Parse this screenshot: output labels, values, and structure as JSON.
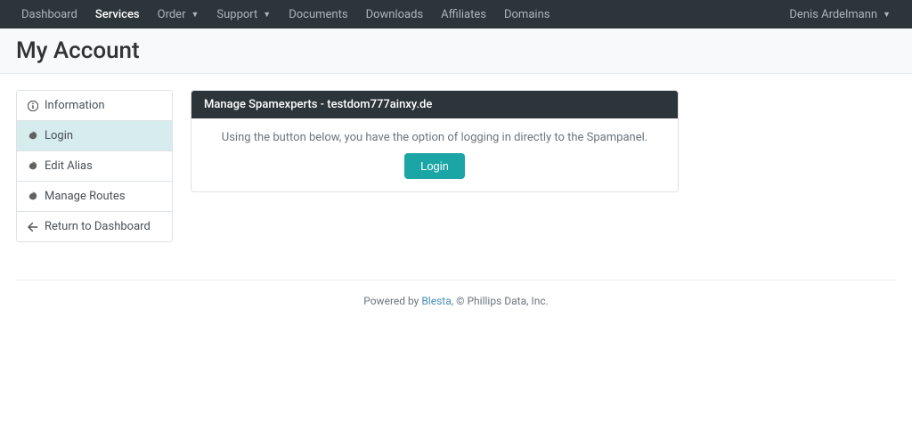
{
  "nav": {
    "items": [
      {
        "label": "Dashboard",
        "active": false,
        "dropdown": false
      },
      {
        "label": "Services",
        "active": true,
        "dropdown": false
      },
      {
        "label": "Order",
        "active": false,
        "dropdown": true
      },
      {
        "label": "Support",
        "active": false,
        "dropdown": true
      },
      {
        "label": "Documents",
        "active": false,
        "dropdown": false
      },
      {
        "label": "Downloads",
        "active": false,
        "dropdown": false
      },
      {
        "label": "Affiliates",
        "active": false,
        "dropdown": false
      },
      {
        "label": "Domains",
        "active": false,
        "dropdown": false
      }
    ],
    "user": "Denis Ardelmann"
  },
  "page": {
    "title": "My Account"
  },
  "sidebar": {
    "items": [
      {
        "icon": "info",
        "label": "Information",
        "active": false
      },
      {
        "icon": "gear",
        "label": "Login",
        "active": true
      },
      {
        "icon": "gear",
        "label": "Edit Alias",
        "active": false
      },
      {
        "icon": "gear",
        "label": "Manage Routes",
        "active": false
      },
      {
        "icon": "arrow-left",
        "label": "Return to Dashboard",
        "active": false
      }
    ]
  },
  "card": {
    "title": "Manage Spamexperts - testdom777ainxy.de",
    "text": "Using the button below, you have the option of logging in directly to the Spampanel.",
    "button": "Login"
  },
  "footer": {
    "prefix": "Powered by ",
    "link": "Blesta",
    "suffix": ", © Phillips Data, Inc."
  }
}
